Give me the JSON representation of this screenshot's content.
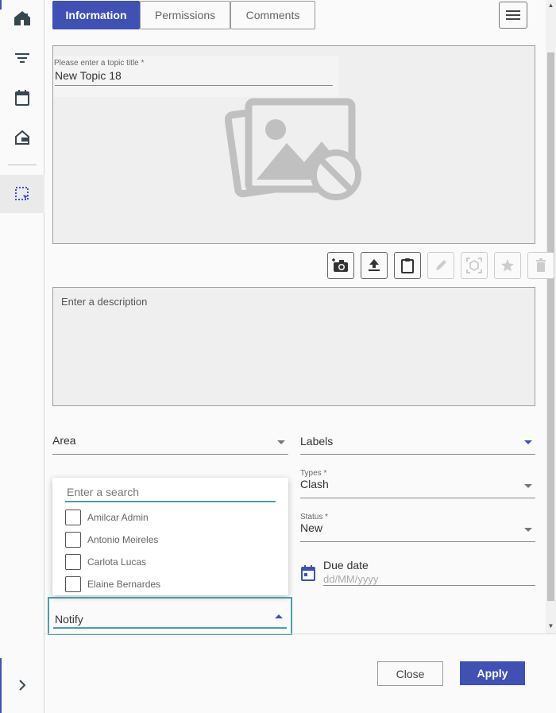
{
  "sidebar": {
    "items": [
      {
        "icon": "home-icon"
      },
      {
        "icon": "filter-icon"
      },
      {
        "icon": "calendar-icon"
      },
      {
        "icon": "exit-home-icon"
      },
      {
        "icon": "selection-icon"
      }
    ],
    "expand_icon": "chevron-right-icon"
  },
  "tabs": [
    {
      "label": "Information",
      "active": true
    },
    {
      "label": "Permissions",
      "active": false
    },
    {
      "label": "Comments",
      "active": false
    }
  ],
  "topic": {
    "title_label": "Please enter a topic title *",
    "title_value": "New Topic  18"
  },
  "description": {
    "placeholder": "Enter a description"
  },
  "fields": {
    "area": {
      "label": "Area"
    },
    "labels": {
      "label": "Labels"
    },
    "types": {
      "label": "Types *",
      "value": "Clash"
    },
    "status": {
      "label": "Status *",
      "value": "New"
    },
    "due_date": {
      "label": "Due date",
      "placeholder": "dd/MM/yyyy"
    }
  },
  "notify": {
    "label": "Notify",
    "search_placeholder": "Enter a search",
    "options": [
      "Amilcar Admin",
      "Antonio Meireles",
      "Carlota Lucas",
      "Elaine Bernardes"
    ]
  },
  "footer": {
    "close_label": "Close",
    "apply_label": "Apply"
  },
  "colors": {
    "accent": "#3f51b5",
    "focus": "#4a9ea8"
  }
}
